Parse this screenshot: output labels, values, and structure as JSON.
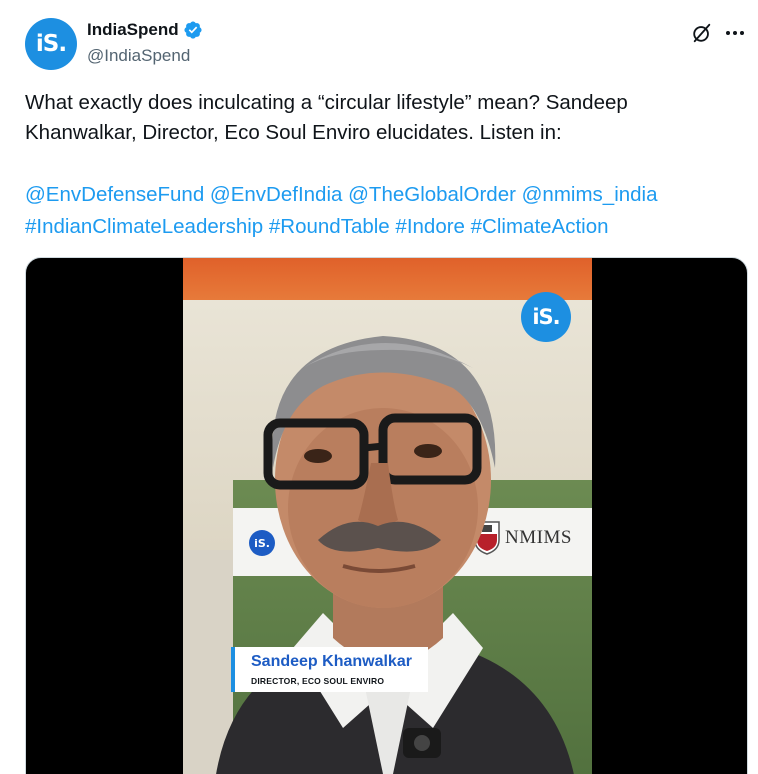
{
  "author": {
    "avatar_text": "iS.",
    "display_name": "IndiaSpend",
    "handle": "@IndiaSpend",
    "verified_icon": "verified-badge-icon"
  },
  "header_icons": {
    "grok": "grok-icon",
    "more": "more-options-icon"
  },
  "tweet": {
    "text": "What exactly does inculcating a “circular lifestyle” mean? Sandeep Khanwalkar, Director, Eco Soul Enviro elucidates. Listen in:",
    "links": [
      "@EnvDefenseFund",
      "@EnvDefIndia",
      "@TheGlobalOrder",
      "@nmims_india",
      "#IndianClimateLeadership",
      "#RoundTable",
      "#Indore",
      "#ClimateAction"
    ]
  },
  "media": {
    "logo_text": "iS.",
    "banner_logo_text": "iS.",
    "banner_text": "NMIMS",
    "lower_third": {
      "name": "Sandeep Khanwalkar",
      "title": "DIRECTOR, ECO SOUL ENVIRO"
    }
  },
  "colors": {
    "accent": "#1d9bf0",
    "text": "#0f1419",
    "secondary": "#536471",
    "brand_blue": "#1d8fe1"
  }
}
